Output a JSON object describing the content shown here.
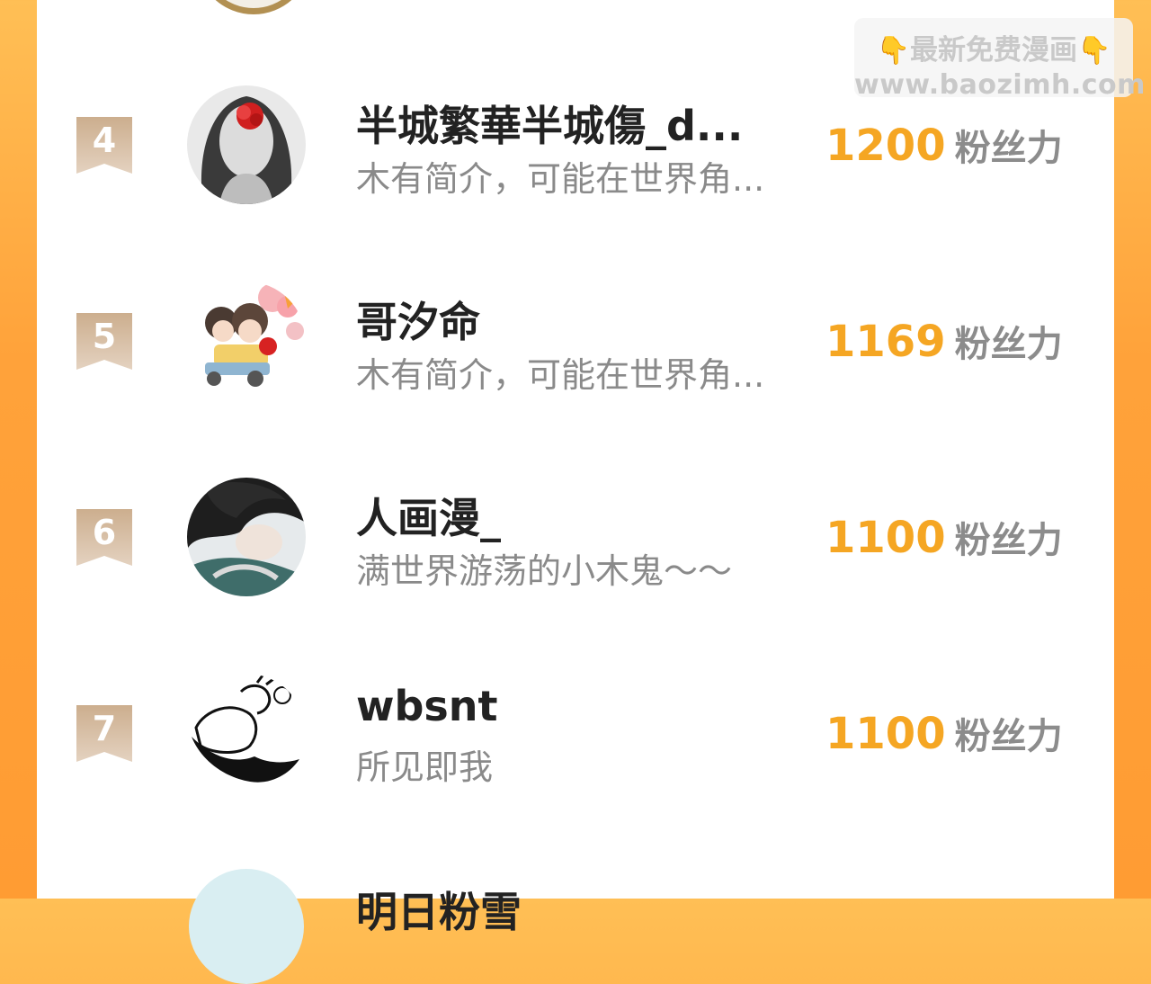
{
  "watermark": {
    "line1": "最新免费漫画",
    "line2": "www.baozimh.com"
  },
  "score_unit": "粉丝力",
  "rows": [
    {
      "rank": "4",
      "name": "半城繁華半城傷_d...",
      "bio": "木有简介，可能在世界角...",
      "score": "1200"
    },
    {
      "rank": "5",
      "name": "哥汐命",
      "bio": "木有简介，可能在世界角...",
      "score": "1169"
    },
    {
      "rank": "6",
      "name": "人画漫_",
      "bio": "满世界游荡的小木鬼～～",
      "score": "1100"
    },
    {
      "rank": "7",
      "name": "wbsnt",
      "bio": "所见即我",
      "score": "1100"
    }
  ],
  "next_row": {
    "name": "明日粉雪"
  },
  "colors": {
    "accent": "#f5a623",
    "badge": "#d2b79a",
    "frame": "#ffa23a"
  }
}
